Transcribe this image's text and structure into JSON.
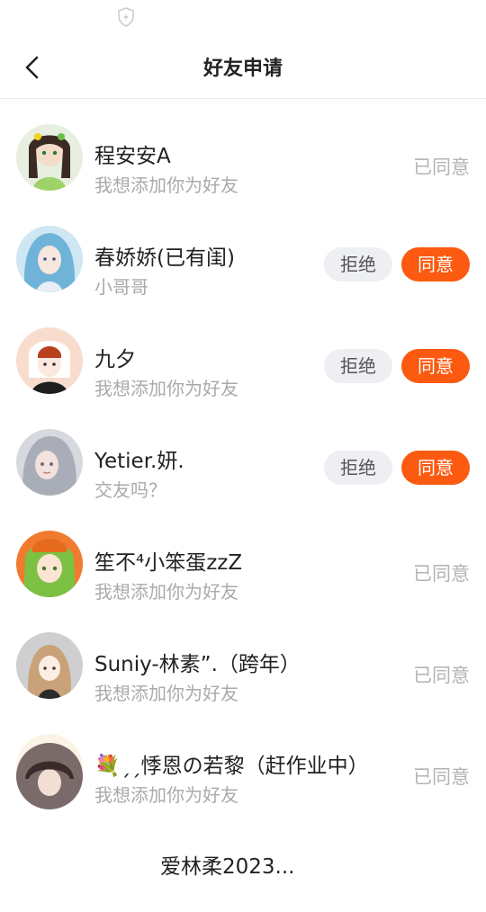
{
  "header": {
    "title": "好友申请"
  },
  "requests": [
    {
      "name": "程安安A",
      "message": "我想添加你为好友",
      "status_text": "已同意",
      "avatar_color": "#cfe3c9"
    },
    {
      "name": "春娇娇(已有闺)",
      "message": "小哥哥",
      "reject_label": "拒绝",
      "agree_label": "同意",
      "avatar_color": "#8fc6e3"
    },
    {
      "name": "九夕",
      "message": "我想添加你为好友",
      "reject_label": "拒绝",
      "agree_label": "同意",
      "avatar_color": "#f6d6c8"
    },
    {
      "name": "Yetier.妍.",
      "message": "交友吗？",
      "reject_label": "拒绝",
      "agree_label": "同意",
      "avatar_color": "#b9bcc4"
    },
    {
      "name": "笙不⁴小笨蛋zzZ",
      "message": "我想添加你为好友",
      "status_text": "已同意",
      "avatar_color": "#8fc94f"
    },
    {
      "name": "Suniy-林素”.（跨年）",
      "message": "我想添加你为好友",
      "status_text": "已同意",
      "avatar_color": "#cfcfcf"
    },
    {
      "name": "💐ˏˏ悸恩の若黎（赶作业中）",
      "message": "我想添加你为好友",
      "status_text": "已同意",
      "avatar_color": "#f5e4c5"
    },
    {
      "name": "爱林柔2023...",
      "avatar_color": "#6b5a5a"
    }
  ],
  "colors": {
    "accent": "#fb5a10",
    "muted_text": "#aaaaaa",
    "reject_bg": "#eeeff3"
  }
}
